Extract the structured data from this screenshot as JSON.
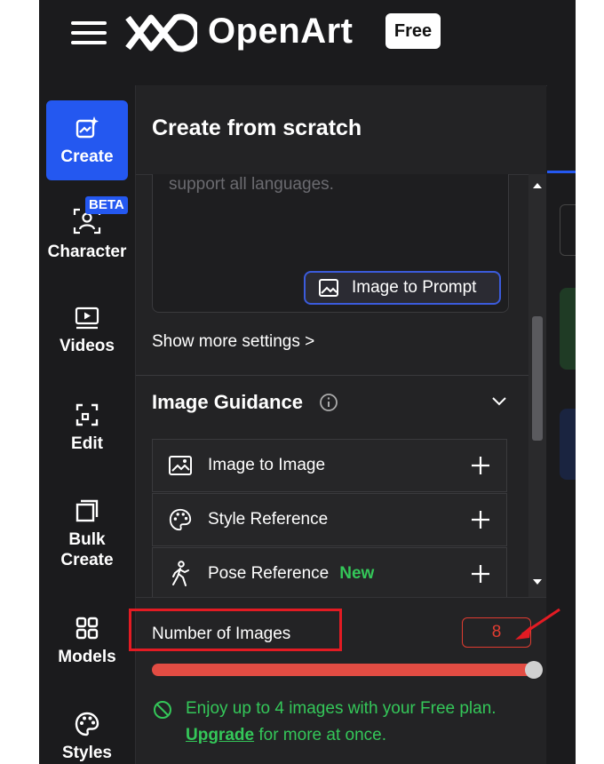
{
  "header": {
    "brand": "OpenArt",
    "plan_badge": "Free"
  },
  "nav": {
    "items": [
      {
        "label": "Create",
        "icon": "sparkle-image-icon",
        "active": true
      },
      {
        "label": "Character",
        "icon": "character-scan-icon",
        "badge": "BETA"
      },
      {
        "label": "Videos",
        "icon": "video-play-icon"
      },
      {
        "label": "Edit",
        "icon": "edit-frame-icon"
      },
      {
        "label": "Bulk Create",
        "icon": "bulk-layers-icon"
      },
      {
        "label": "Models",
        "icon": "grid-models-icon"
      },
      {
        "label": "Styles",
        "icon": "palette-icon"
      }
    ]
  },
  "panel": {
    "title": "Create from scratch",
    "prompt_hint": "support all languages.",
    "image_to_prompt_label": "Image to Prompt",
    "show_more_label": "Show more settings >",
    "image_guidance_title": "Image Guidance",
    "guidance_rows": [
      {
        "label": "Image to Image",
        "icon": "image-icon"
      },
      {
        "label": "Style Reference",
        "icon": "palette-icon"
      },
      {
        "label": "Pose Reference",
        "icon": "walking-figure-icon",
        "tag": "New"
      }
    ]
  },
  "number_of_images": {
    "label": "Number of Images",
    "value": "8",
    "slider_fraction": 1.0,
    "notice_text": "Enjoy up to 4 images with your Free plan.",
    "upgrade_link": "Upgrade",
    "notice_suffix": " for more at once."
  },
  "colors": {
    "accent_blue": "#2458f0",
    "success_green": "#34c759",
    "annotation_red": "#e31b23",
    "slider_red": "#e24c43"
  }
}
